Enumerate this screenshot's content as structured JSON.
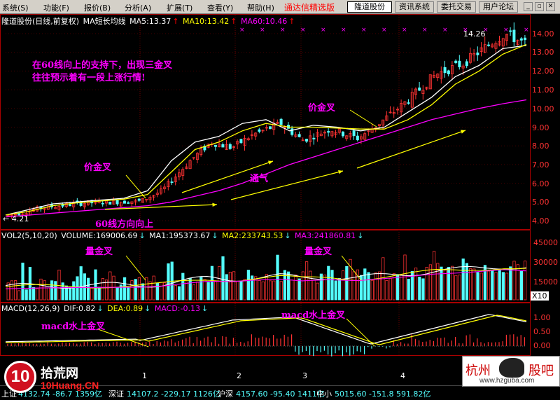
{
  "menubar": {
    "items": [
      "系统(S)",
      "功能(F)",
      "报价(B)",
      "分析(A)",
      "扩展(T)",
      "查看(Y)",
      "帮助(H)"
    ],
    "title": "通达信精选版",
    "buttons": [
      "隆道股份",
      "资讯系统",
      "委托交易",
      "用户论坛"
    ],
    "active_button": "隆道股份"
  },
  "price_panel": {
    "header": {
      "name": "隆道股份(日线,前复权)",
      "indicator": "MA短长均线",
      "ma5": "MA5:13.37",
      "ma10": "MA10:13.42",
      "ma60": "MA60:10.46"
    },
    "y_ticks": [
      "14.00",
      "13.00",
      "12.00",
      "11.00",
      "10.00",
      "9.00",
      "8.00",
      "7.00",
      "6.00",
      "5.00",
      "4.00"
    ],
    "high_label": "14.26",
    "low_label": "4.21",
    "annotations": {
      "main_text_1": "在60线向上的支持下，出现三金叉",
      "main_text_2": "往往预示着有一段上涨行情!",
      "price_cross_1": "价金叉",
      "price_cross_2": "价金叉",
      "tongqi": "通气",
      "ma60_up": "60线方向向上"
    }
  },
  "volume_panel": {
    "header": {
      "vol": "VOL2(5,10,20)",
      "volume": "VOLUME:169006.69",
      "ma1": "MA1:195373.67",
      "ma2": "MA2:233743.53",
      "ma3": "MA3:241860.81"
    },
    "y_ticks": [
      "45000",
      "30000",
      "15000"
    ],
    "unit": "X10",
    "annotations": {
      "vol_cross_1": "量金叉",
      "vol_cross_2": "量金叉"
    }
  },
  "macd_panel": {
    "header": {
      "macd": "MACD(12,26,9)",
      "dif": "DIF:0.82",
      "dea": "DEA:0.89",
      "macdv": "MACD:-0.13"
    },
    "y_ticks": [
      "1.00",
      "0.50",
      "0.00"
    ],
    "annotations": {
      "macd_cross_1": "macd水上金叉",
      "macd_cross_2": "macd水上金叉"
    }
  },
  "time_axis": {
    "labels": [
      "1",
      "2",
      "3",
      "4"
    ]
  },
  "statusbar": {
    "item1_name": "上证",
    "item1_vals": "4132.74 -86.7 1359亿",
    "item2_name": "深证",
    "item2_vals": "14107.2 -229.17 1126亿",
    "item3_name": "沪深",
    "item3_vals": "4157.60 -95.40 1411亿",
    "item4_name": "中小",
    "item4_vals": "5015.60 -151.8 591.82亿"
  },
  "watermarks": {
    "left_logo": "10",
    "left_text": "拾荒网",
    "left_url": "10Huang.CN",
    "right_text_1": "杭州",
    "right_text_2": "股吧",
    "right_url": "www.hzguba.com"
  },
  "colors": {
    "up": "#ff3232",
    "down": "#54ffff",
    "ma5": "#ffffff",
    "ma10": "#ffff00",
    "ma60": "#ff00ff",
    "annotation": "#ff00ff"
  },
  "chart_data": {
    "type": "line",
    "title": "",
    "xlabel": "",
    "ylabel": "",
    "ylim": [
      4.0,
      14.5
    ],
    "series": [
      {
        "name": "MA5",
        "values": [
          4.3,
          4.6,
          4.9,
          5.0,
          5.1,
          5.2,
          5.6,
          7.2,
          8.2,
          8.5,
          9.2,
          9.4,
          8.8,
          9.1,
          9.0,
          8.8,
          9.0,
          9.8,
          10.6,
          11.7,
          12.3,
          13.2,
          13.37
        ]
      },
      {
        "name": "MA10",
        "values": [
          4.3,
          4.5,
          4.8,
          4.95,
          5.05,
          5.15,
          5.4,
          6.6,
          7.8,
          8.2,
          8.8,
          9.2,
          9.0,
          9.0,
          8.95,
          8.9,
          8.9,
          9.4,
          10.2,
          11.3,
          12.0,
          12.9,
          13.42
        ]
      },
      {
        "name": "MA60",
        "values": [
          4.2,
          4.3,
          4.4,
          4.5,
          4.6,
          4.7,
          4.8,
          5.0,
          5.3,
          5.6,
          6.0,
          6.5,
          7.0,
          7.4,
          7.8,
          8.2,
          8.6,
          9.0,
          9.4,
          9.7,
          10.0,
          10.25,
          10.46
        ]
      }
    ]
  }
}
